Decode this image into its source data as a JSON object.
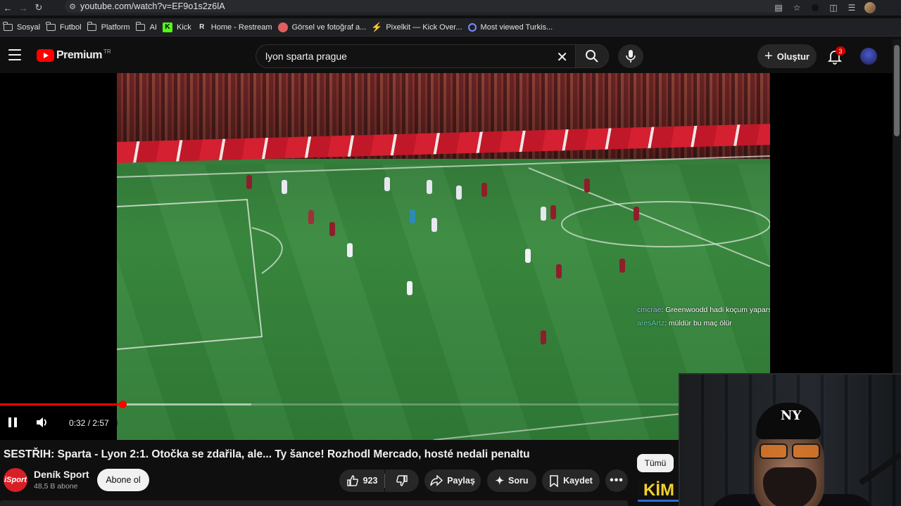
{
  "browser": {
    "url": "youtube.com/watch?v=EF9o1s2z6lA",
    "bookmarks": [
      {
        "label": "Sosyal",
        "icon": "folder-icon"
      },
      {
        "label": "Futbol",
        "icon": "folder-icon"
      },
      {
        "label": "Platform",
        "icon": "folder-icon"
      },
      {
        "label": "AI",
        "icon": "folder-icon"
      },
      {
        "label": "Kick",
        "icon": "kick-icon"
      },
      {
        "label": "Home - Restream",
        "icon": "restream-icon"
      },
      {
        "label": "Görsel ve fotoğraf a...",
        "icon": "image-site-icon"
      },
      {
        "label": "Pixelkit — Kick Over...",
        "icon": "pixelkit-icon"
      },
      {
        "label": "Most viewed Turkis...",
        "icon": "stats-icon"
      }
    ]
  },
  "header": {
    "logo_text": "Premium",
    "logo_country": "TR",
    "search_query": "lyon sparta prague",
    "create_label": "Oluştur",
    "notification_count": "3"
  },
  "player": {
    "time": "0:32 / 2:57",
    "progress_fraction": 0.181,
    "buffered_fraction": 0.37,
    "chat": [
      {
        "user": "cmcrae",
        "text": ": Greenwoodd hadi koçum yaparsın"
      },
      {
        "user": "aresArtz",
        "text": ": müldür bu maç ölür"
      }
    ]
  },
  "video": {
    "title": "SESTŘIH: Sparta - Lyon 2:1. Otočka se zdařila, ale... Ty šance! Rozhodl Mercado, hosté nedali penaltu",
    "channel_name": "Deník Sport",
    "channel_avatar_text": "iSport",
    "subscribers": "48,5 B abone",
    "subscribe_label": "Abone ol",
    "likes": "923",
    "share_label": "Paylaş",
    "ask_label": "Soru",
    "save_label": "Kaydet"
  },
  "sidebar": {
    "filter_label": "Tümü",
    "thumb_text": "KİM"
  },
  "colors": {
    "accent": "#ff0000",
    "background": "#0f0f0f",
    "chip": "#272727"
  }
}
